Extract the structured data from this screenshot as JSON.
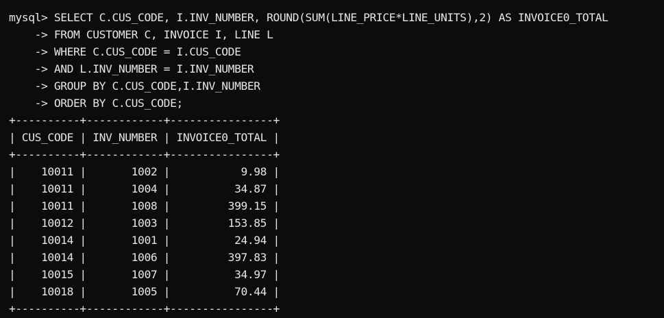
{
  "terminal": {
    "prompt": "mysql> ",
    "continuation_prompt": "    -> ",
    "query_lines": [
      "SELECT C.CUS_CODE, I.INV_NUMBER, ROUND(SUM(LINE_PRICE*LINE_UNITS),2) AS INVOICE0_TOTAL",
      "FROM CUSTOMER C, INVOICE I, LINE L",
      "WHERE C.CUS_CODE = I.CUS_CODE",
      "AND L.INV_NUMBER = I.INV_NUMBER",
      "GROUP BY C.CUS_CODE,I.INV_NUMBER",
      "ORDER BY C.CUS_CODE;"
    ],
    "table": {
      "border": "+----------+------------+----------------+",
      "header": "| CUS_CODE | INV_NUMBER | INVOICE0_TOTAL |",
      "rows": [
        "|    10011 |       1002 |           9.98 |",
        "|    10011 |       1004 |          34.87 |",
        "|    10011 |       1008 |         399.15 |",
        "|    10012 |       1003 |         153.85 |",
        "|    10014 |       1001 |          24.94 |",
        "|    10014 |       1006 |         397.83 |",
        "|    10015 |       1007 |          34.97 |",
        "|    10018 |       1005 |          70.44 |"
      ]
    }
  },
  "colors": {
    "background": "#0c0c0c",
    "text": "#e6e6e6"
  }
}
